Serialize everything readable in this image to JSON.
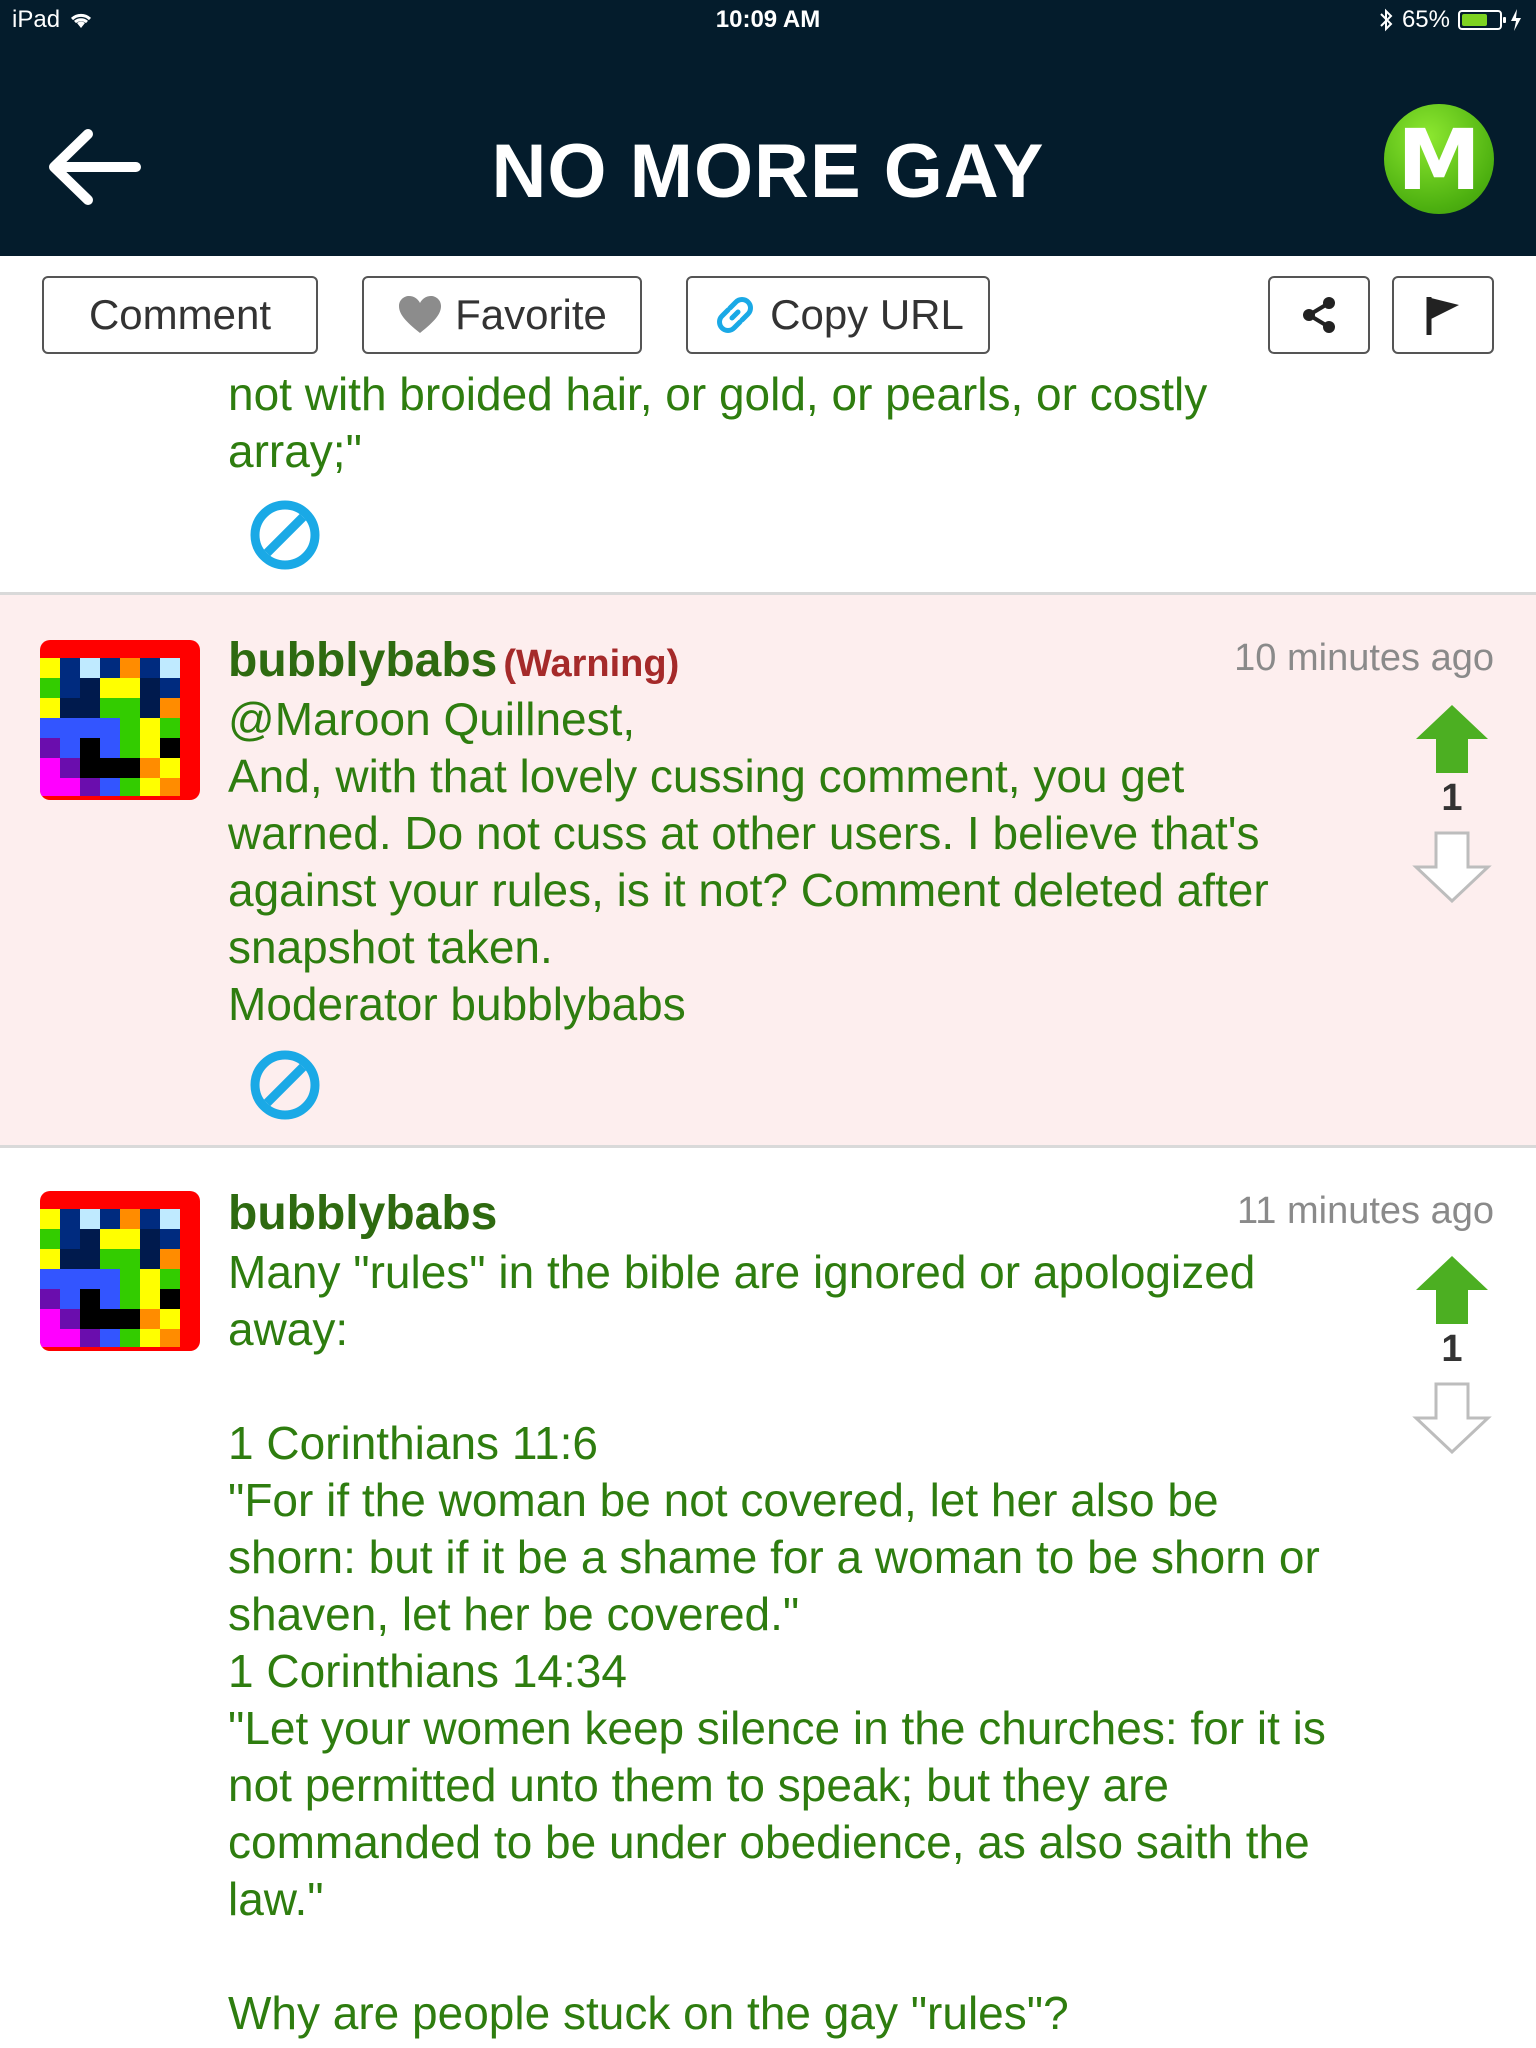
{
  "status_bar": {
    "device": "iPad",
    "time": "10:09 AM",
    "battery": "65%",
    "battery_level": 0.65
  },
  "header": {
    "title": "NO MORE GAY",
    "logo_letter": "M"
  },
  "actions": {
    "comment_label": "Comment",
    "favorite_label": "Favorite",
    "copy_url_label": "Copy URL"
  },
  "previous_comment": {
    "text": "not with broided hair, or gold, or pearls, or costly array;\""
  },
  "comments": [
    {
      "username": "bubblybabs",
      "badge": "(Warning)",
      "time_ago": "10 minutes ago",
      "body": "@Maroon Quillnest,\nAnd, with that lovely cussing comment, you get warned. Do not cuss at other users. I believe that's against your rules, is it not? Comment deleted after snapshot taken.\nModerator bubblybabs",
      "votes": "1"
    },
    {
      "username": "bubblybabs",
      "time_ago": "11 minutes ago",
      "body": "Many \"rules\" in the bible are ignored or apologized away:\n\n1 Corinthians 11:6\n\"For if the woman be not covered, let her also be shorn: but if it be a shame for a woman to be shorn or shaven, let her be covered.\"\n1 Corinthians 14:34\n\"Let your women keep silence in the churches: for it is not permitted unto them to speak; but they are commanded to be under obedience, as also saith the law.\"\n\nWhy are people stuck on the gay \"rules\"?",
      "votes": "1"
    }
  ],
  "colors": {
    "header_bg": "#041c2c",
    "comment_text": "#2e7d0f",
    "username": "#2e6a10",
    "warning": "#a52a2a",
    "upvote": "#4caf22",
    "ban_icon": "#1aa9e6",
    "warning_row_bg": "#fdeeee"
  },
  "icons": [
    "wifi-icon",
    "bluetooth-icon",
    "battery-icon",
    "back-arrow-icon",
    "heart-icon",
    "link-icon",
    "share-icon",
    "flag-icon",
    "ban-icon",
    "upvote-arrow-icon",
    "downvote-arrow-icon"
  ]
}
